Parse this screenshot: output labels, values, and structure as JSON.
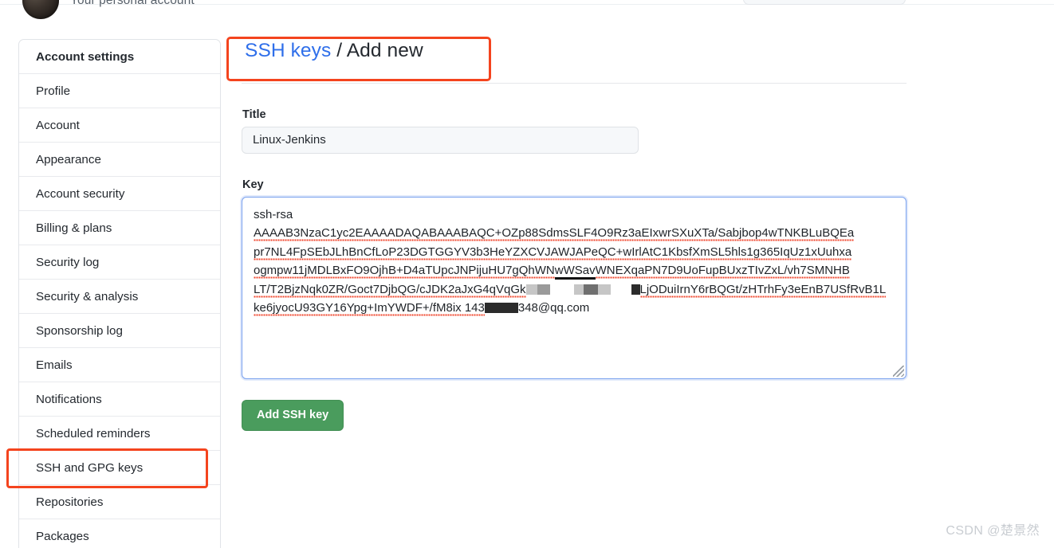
{
  "header": {
    "account_label": "Your personal account",
    "avatar_name": "user-avatar"
  },
  "sidebar": {
    "items": [
      {
        "label": "Account settings",
        "is_header": true
      },
      {
        "label": "Profile",
        "is_header": false
      },
      {
        "label": "Account",
        "is_header": false
      },
      {
        "label": "Appearance",
        "is_header": false
      },
      {
        "label": "Account security",
        "is_header": false
      },
      {
        "label": "Billing & plans",
        "is_header": false
      },
      {
        "label": "Security log",
        "is_header": false
      },
      {
        "label": "Security & analysis",
        "is_header": false
      },
      {
        "label": "Sponsorship log",
        "is_header": false
      },
      {
        "label": "Emails",
        "is_header": false
      },
      {
        "label": "Notifications",
        "is_header": false
      },
      {
        "label": "Scheduled reminders",
        "is_header": false
      },
      {
        "label": "SSH and GPG keys",
        "is_header": false
      },
      {
        "label": "Repositories",
        "is_header": false
      },
      {
        "label": "Packages",
        "is_header": false
      }
    ],
    "highlighted_item": "SSH and GPG keys"
  },
  "main": {
    "title_link": "SSH keys",
    "title_separator": " / ",
    "title_current": "Add new",
    "title_label": "Title",
    "title_value": "Linux-Jenkins",
    "title_placeholder": "",
    "key_label": "Key",
    "key_line_1": "ssh-rsa",
    "key_line_2": "AAAAB3NzaC1yc2EAAAADAQABAAABAQC+OZp88SdmsSLF4O9Rz3aEIxwrSXuXTa/Sabjbop4wTNKBLuBQEa",
    "key_line_3": "pr7NL4FpSEbJLhBnCfLoP23DGTGGYV3b3HeYZXCVJAWJAPeQC+wIrlAtC1KbsfXmSL5hls1g365IqUz1xUuhxa",
    "key_line_4_a": "ogmpw11jMDLBxFO9OjhB+D4aTUpcJNPijuHU7gQhWN",
    "key_line_4_b": "wWS",
    "key_line_4_c": "av",
    "key_line_4_d": "WNEXqaPN7D9UoFupBUxzTIvZxL/vh7SMNHB",
    "key_line_5_a": "LT/T2BjzNqk0ZR/Goct7DjbQG/cJDK2aJxG4qVqGk",
    "key_line_5_redacted": "[redacted]",
    "key_line_5_b": "LjODuiIrnY6rBQGt/zHTrhFy3eEnB7USfRvB1L",
    "key_line_6_a": "ke6jyocU93GY16Ypg+ImYWDF+/fM8ix 143",
    "key_line_6_redacted": "[redacted]",
    "key_line_6_b": "348@qq.com",
    "submit_label": "Add SSH key"
  },
  "annotations": {
    "color": "#f4441e",
    "title_box": "SSH keys / Add new",
    "sidebar_box": "SSH and GPG keys"
  },
  "watermark": {
    "text": "CSDN @楚景然"
  },
  "colors": {
    "link_blue": "#2f6fea",
    "button_green": "#4a9c5d",
    "annotation_red": "#f4441e",
    "focus_border_blue": "#79a1ee",
    "spellcheck_red": "#f0462c"
  }
}
